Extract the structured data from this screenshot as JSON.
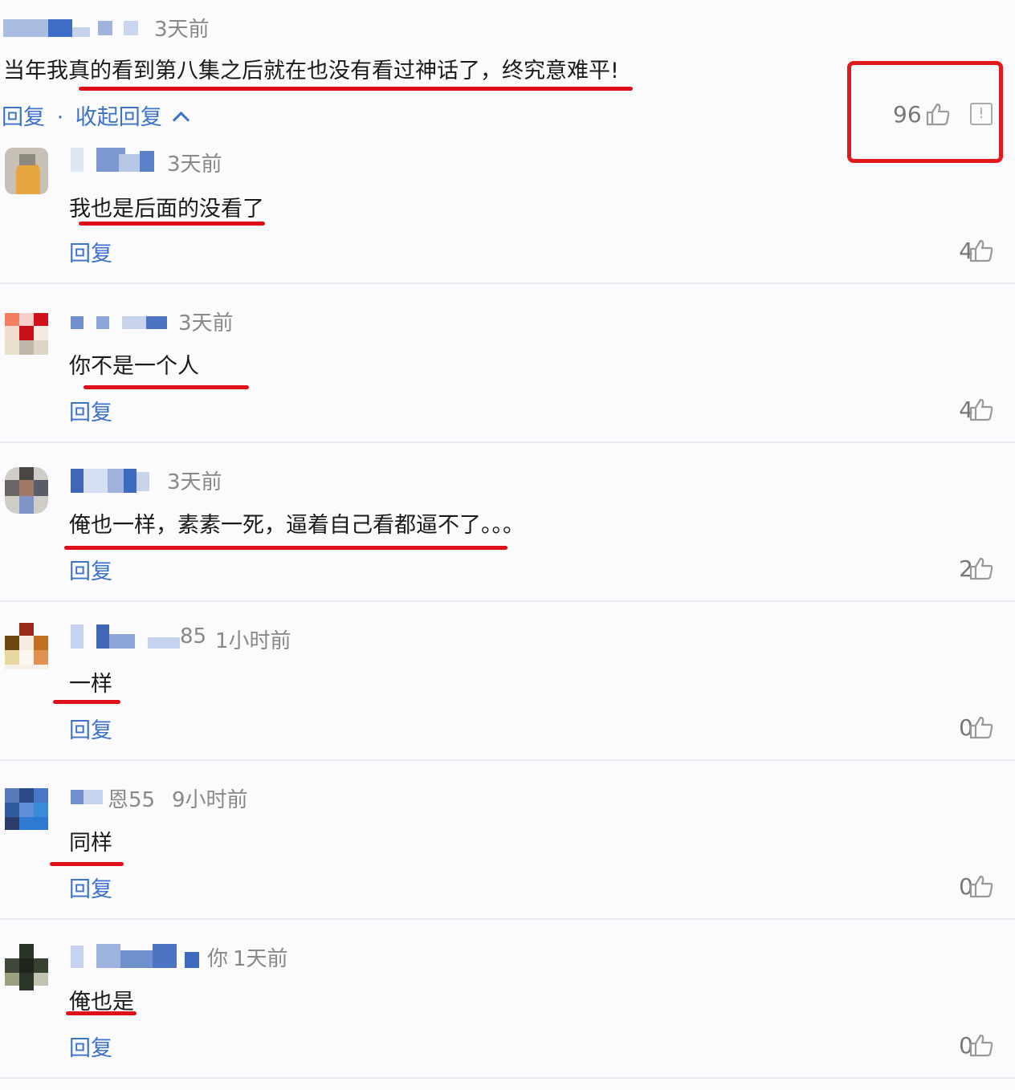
{
  "main_comment": {
    "time": "3天前",
    "text": "当年我真的看到第八集之后就在也没有看过神话了，终究意难平!",
    "reply_label": "回复",
    "separator": "·",
    "collapse_label": "收起回复",
    "likes": "96"
  },
  "replies": [
    {
      "time": "3天前",
      "text": "我也是后面的没看了",
      "reply_label": "回复",
      "likes": "4"
    },
    {
      "time": "3天前",
      "text": "你不是一个人",
      "reply_label": "回复",
      "likes": "4"
    },
    {
      "time": "3天前",
      "text": "俺也一样，素素一死，逼着自己看都逼不了。。。",
      "reply_label": "回复",
      "likes": "2"
    },
    {
      "name_suffix": "85",
      "time": "1小时前",
      "text": "一样",
      "reply_label": "回复",
      "likes": "0"
    },
    {
      "name_suffix": "恩55",
      "time": "9小时前",
      "text": "同样",
      "reply_label": "回复",
      "likes": "0"
    },
    {
      "name_suffix": "你",
      "time": "1天前",
      "text": "俺也是",
      "reply_label": "回复",
      "likes": "0"
    }
  ],
  "colors": {
    "link": "#3d72c9",
    "highlight": "#e01a1a"
  }
}
